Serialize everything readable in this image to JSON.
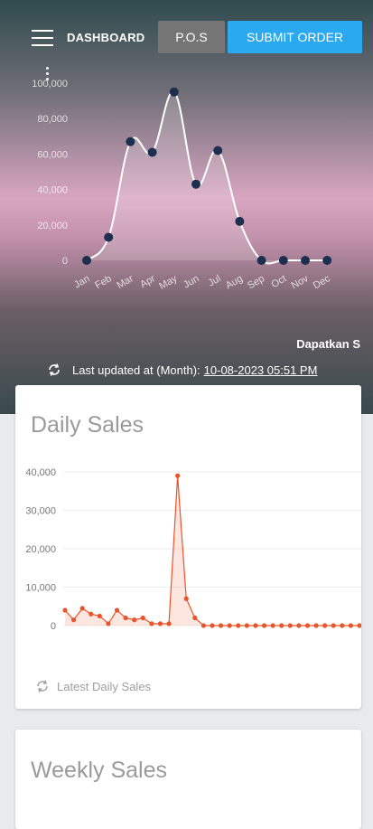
{
  "header": {
    "title": "DASHBOARD",
    "pos_label": "P.O.S",
    "submit_label": "SUBMIT ORDER"
  },
  "monthly": {
    "cta_text": "Dapatkan S",
    "updated_label": "Last updated at (Month):",
    "updated_value": "10-08-2023 05:51 PM"
  },
  "daily_card": {
    "title": "Daily Sales",
    "footer": "Latest Daily Sales"
  },
  "weekly_card": {
    "title": "Weekly Sales"
  },
  "colors": {
    "primary_button": "#2aa8f0",
    "secondary_button": "#757575",
    "daily_line": "#e8552a",
    "monthly_point": "#1d2f4f"
  },
  "chart_data": [
    {
      "type": "line",
      "categories": [
        "Jan",
        "Feb",
        "Mar",
        "Apr",
        "May",
        "Jun",
        "Jul",
        "Aug",
        "Sep",
        "Oct",
        "Nov",
        "Dec"
      ],
      "values": [
        0,
        13000,
        67000,
        61000,
        95000,
        43000,
        62000,
        22000,
        0,
        0,
        0,
        0
      ],
      "yticks": [
        "0",
        "20,000",
        "40,000",
        "60,000",
        "80,000",
        "100,000"
      ],
      "ylim": [
        0,
        100000
      ],
      "grid": false
    },
    {
      "type": "line",
      "values": [
        4000,
        1500,
        4500,
        3000,
        2500,
        500,
        4000,
        2000,
        1500,
        2000,
        500,
        500,
        500,
        39000,
        7000,
        2000,
        0,
        0,
        0,
        0,
        0,
        0,
        0,
        0,
        0,
        0,
        0,
        0,
        0,
        0,
        0,
        0,
        0,
        0,
        0
      ],
      "yticks": [
        "0",
        "10,000",
        "20,000",
        "30,000",
        "40,000"
      ],
      "ylim": [
        0,
        40000
      ],
      "grid": true
    }
  ]
}
